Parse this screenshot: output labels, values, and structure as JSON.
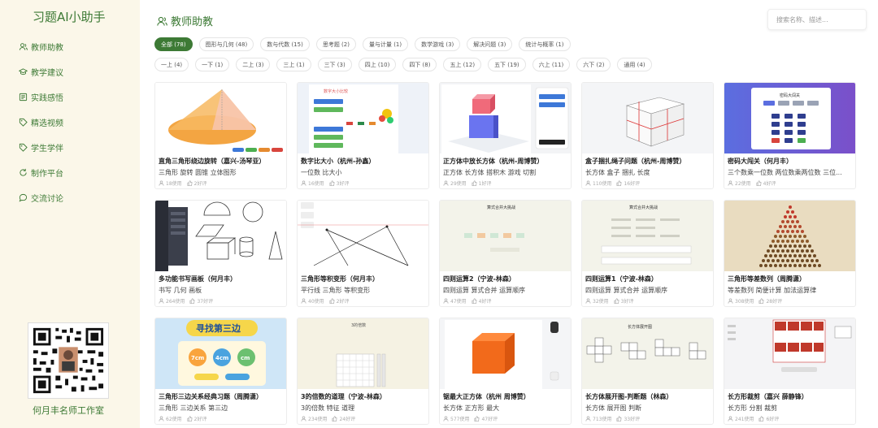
{
  "app": {
    "title": "习题AI小助手"
  },
  "nav": [
    {
      "label": "教师助教",
      "icon": "users-icon"
    },
    {
      "label": "教学建议",
      "icon": "graduation-cap-icon"
    },
    {
      "label": "实践感悟",
      "icon": "notebook-icon"
    },
    {
      "label": "精选视频",
      "icon": "tag-icon"
    },
    {
      "label": "学生学伴",
      "icon": "tag-icon"
    },
    {
      "label": "制作平台",
      "icon": "refresh-icon"
    },
    {
      "label": "交流讨论",
      "icon": "chat-icon"
    }
  ],
  "footer": {
    "qr_caption": "何月丰名师工作室"
  },
  "page": {
    "title": "教师助教",
    "title_icon": "users-icon"
  },
  "search": {
    "placeholder": "搜索名称、描述..."
  },
  "filters": {
    "categories": [
      {
        "label": "全部 (78)",
        "active": true
      },
      {
        "label": "图形与几何 (48)"
      },
      {
        "label": "数与代数 (15)"
      },
      {
        "label": "思考题 (2)"
      },
      {
        "label": "量与计量 (1)"
      },
      {
        "label": "数学游戏 (3)"
      },
      {
        "label": "解决问题 (3)"
      },
      {
        "label": "统计与概率 (1)"
      }
    ],
    "grades": [
      {
        "label": "一上 (4)"
      },
      {
        "label": "一下 (1)"
      },
      {
        "label": "二上 (3)"
      },
      {
        "label": "三上 (1)"
      },
      {
        "label": "三下 (3)"
      },
      {
        "label": "四上 (10)"
      },
      {
        "label": "四下 (8)"
      },
      {
        "label": "五上 (12)"
      },
      {
        "label": "五下 (19)"
      },
      {
        "label": "六上 (11)"
      },
      {
        "label": "六下 (2)"
      },
      {
        "label": "通用 (4)"
      }
    ]
  },
  "cards": [
    {
      "title": "直角三角形绕边旋转（嘉兴-汤琴亚）",
      "tags": "三角形 旋转 圆锥 立体图形",
      "uses": "18使用",
      "likes": "2好评"
    },
    {
      "title": "数字比大小（杭州-孙鑫）",
      "tags": "一位数 比大小",
      "uses": "16使用",
      "likes": "3好评"
    },
    {
      "title": "正方体中放长方体（杭州-周博赞）",
      "tags": "正方体 长方体 搭积木 游戏 切割",
      "uses": "29使用",
      "likes": "1好评"
    },
    {
      "title": "盒子捆扎绳子问题（杭州-周博赞）",
      "tags": "长方体 盒子 捆扎 长度",
      "uses": "110使用",
      "likes": "16好评"
    },
    {
      "title": "密码大闯关（何月丰）",
      "tags": "三个数乘一位数 两位数乘两位数 三位...",
      "uses": "22使用",
      "likes": "4好评"
    },
    {
      "title": "多功能书写画板（何月丰）",
      "tags": "书写 几何 画板",
      "uses": "264使用",
      "likes": "37好评"
    },
    {
      "title": "三角形等积变形（何月丰）",
      "tags": "平行线 三角形 等积变形",
      "uses": "40使用",
      "likes": "2好评"
    },
    {
      "title": "四则运算2（宁波-林森）",
      "tags": "四则运算 算式合并 运算顺序",
      "uses": "47使用",
      "likes": "4好评"
    },
    {
      "title": "四则运算1（宁波-林森）",
      "tags": "四则运算 算式合并 运算顺序",
      "uses": "32使用",
      "likes": "3好评"
    },
    {
      "title": "三角形等差数列（周腾潇）",
      "tags": "等差数列 简便计算 加法运算律",
      "uses": "308使用",
      "likes": "28好评"
    },
    {
      "title": "三角形三边关系经典习题（周腾潇）",
      "tags": "三角形 三边关系 第三边",
      "uses": "62使用",
      "likes": "2好评"
    },
    {
      "title": "3的倍数的道理（宁波-林森）",
      "tags": "3的倍数 特征 道理",
      "uses": "234使用",
      "likes": "24好评"
    },
    {
      "title": "锯最大正方体（杭州 周博赞）",
      "tags": "长方体 正方形 最大",
      "uses": "577使用",
      "likes": "47好评"
    },
    {
      "title": "长方体展开图-判断题（林森）",
      "tags": "长方体 展开图 判断",
      "uses": "713使用",
      "likes": "33好评"
    },
    {
      "title": "长方形裁剪（嘉兴 薛静锋）",
      "tags": "长方形 分割 裁剪",
      "uses": "241使用",
      "likes": "6好评"
    }
  ],
  "thumb_texts": {
    "t2_header": "数字大小比较",
    "t5_header": "密码大闯关",
    "t8_header": "算式合并大挑战",
    "t9_header": "算式合并大挑战",
    "t11_title": "寻找第三边",
    "t11_l1": "7cm",
    "t11_l2": "4cm",
    "t11_l3": "cm",
    "t12_header": "3的倍数",
    "t14_header": "长方体展开图"
  },
  "colors": {
    "accent": "#3d7a35",
    "sidebar_bg": "#fbf7e9"
  }
}
